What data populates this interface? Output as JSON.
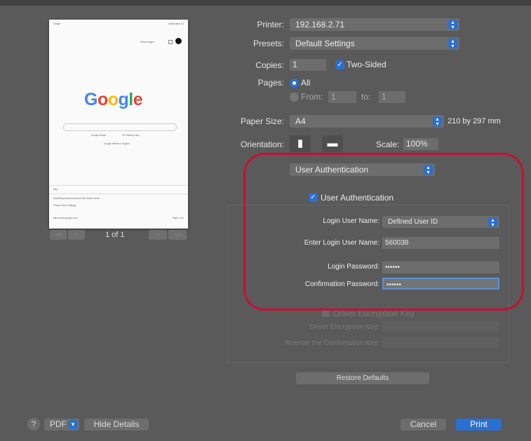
{
  "preview": {
    "page_header_left": "Google",
    "page_header_right": "about:blank 1/1",
    "top_links": "Gmail  Images",
    "logo_letters": [
      "G",
      "o",
      "o",
      "g",
      "l",
      "e"
    ],
    "button1": "Google Search",
    "button2": "I'm Feeling Lucky",
    "offered_in": "Google offered in: English",
    "footer_country": "Italy",
    "footer_links1": "Advertising   Business   About   How Search works",
    "footer_links2": "Privacy   Terms   Settings",
    "footer_bottom_left": "https://www.google.com/",
    "footer_bottom_right": "Page 1 of 1",
    "nav_first": "<<",
    "nav_prev": "<",
    "nav_next": ">",
    "nav_last": ">>",
    "page_count": "1 of 1"
  },
  "printer": {
    "label": "Printer:",
    "value": "192.168.2.71"
  },
  "presets": {
    "label": "Presets:",
    "value": "Default Settings"
  },
  "copies": {
    "label": "Copies:",
    "value": "1",
    "two_sided": "Two-Sided"
  },
  "pages": {
    "label": "Pages:",
    "all": "All",
    "from_label": "From:",
    "from_value": "1",
    "to_label": "to:",
    "to_value": "1"
  },
  "paper_size": {
    "label": "Paper Size:",
    "value": "A4",
    "dims": "210 by 297 mm"
  },
  "orientation": {
    "label": "Orientation:",
    "scale_label": "Scale:",
    "scale_value": "100%"
  },
  "section_popup": {
    "value": "User Authentication"
  },
  "user_auth": {
    "checkbox_label": "User Authentication",
    "login_name_label": "Login User Name:",
    "login_name_value": "Defined User ID",
    "enter_name_label": "Enter Login User Name:",
    "enter_name_value": "560038",
    "password_label": "Login Password:",
    "password_value": "••••••",
    "confirm_label": "Confirmation Password:",
    "confirm_value": "••••••"
  },
  "encryption": {
    "checkbox_label": "Driver Encryption Key",
    "key_label": "Driver Encryption Key:",
    "confirm_label": "Reenter the Confirmation Key:"
  },
  "restore_defaults": "Restore Defaults",
  "bottom": {
    "help": "?",
    "pdf": "PDF",
    "hide_details": "Hide Details",
    "cancel": "Cancel",
    "print": "Print"
  },
  "colors": {
    "accent": "#2a6fd2",
    "annotation": "#c8102e",
    "dialog_bg": "#5a5a5a"
  },
  "icons": [
    "help-icon",
    "chevron-updown-icon",
    "checkmark-icon",
    "portrait-orientation-icon",
    "landscape-orientation-icon",
    "chevron-down-icon"
  ]
}
